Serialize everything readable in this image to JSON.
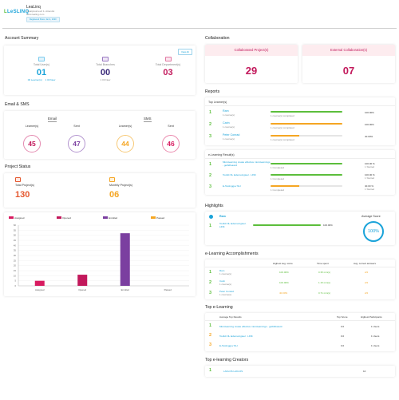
{
  "app": {
    "logo_text": "LeSLINQ",
    "company_name": "LeaLinq",
    "company_line1": "Cuiatpisurnevd 1- Attendst",
    "company_line2": "www.lealing.com",
    "company_button": "Registered Since: Jan 1, 2020"
  },
  "colors": {
    "primary_blue": "#1aa3d9",
    "green": "#5cbe3c",
    "orange": "#f5a623",
    "pink": "#d81b60",
    "purple": "#7b3fa0",
    "magenta": "#c2185b"
  },
  "account_summary": {
    "title": "Account Summary",
    "view_all": "View All",
    "stats": [
      {
        "label": "Total User(s)",
        "value": "01",
        "sub1": "00 Learner(s)",
        "sub2": "1 00 New",
        "color": "#1aa3d9",
        "icon": "users-icon"
      },
      {
        "label": "Total Branches",
        "value": "00",
        "sub1": "",
        "sub2": "1 00 New",
        "color": "#3a2a7a",
        "icon": "branch-icon"
      },
      {
        "label": "Total Department(s)",
        "value": "03",
        "sub1": "",
        "sub2": "",
        "color": "#c2185b",
        "icon": "department-icon"
      }
    ]
  },
  "email_sms": {
    "title": "Email & SMS",
    "email_label": "Email",
    "sms_label": "SMS",
    "rings": [
      {
        "label": "Learner(s)",
        "value": "45",
        "color": "#c2185b"
      },
      {
        "label": "Sent",
        "value": "47",
        "color": "#7b3fa0"
      },
      {
        "label": "Learner(s)",
        "value": "44",
        "color": "#f5a623"
      },
      {
        "label": "Sent",
        "value": "46",
        "color": "#d81b60"
      }
    ]
  },
  "project_status": {
    "title": "Project Status",
    "total_label": "Total Project(s)",
    "total_value": "130",
    "monthly_label": "Monthly Project(s)",
    "monthly_value": "06"
  },
  "chart_data": {
    "type": "bar",
    "legend": [
      {
        "name": "Assigned",
        "color": "#d81b60"
      },
      {
        "name": "Opened",
        "color": "#c2185b"
      },
      {
        "name": "Enrolled",
        "color": "#7b3fa0"
      },
      {
        "name": "Passed",
        "color": "#f5a623"
      }
    ],
    "categories": [
      "Assigned",
      "Opened",
      "Enrolled",
      "Passed"
    ],
    "values": [
      5,
      11,
      52,
      0
    ],
    "colors": [
      "#d81b60",
      "#c2185b",
      "#7b3fa0",
      "#f5a623"
    ],
    "yticks": [
      "60",
      "55",
      "50",
      "45",
      "40",
      "35",
      "30",
      "25",
      "20",
      "15",
      "10",
      "5",
      "0"
    ],
    "ylim": [
      0,
      60
    ]
  },
  "collaboration": {
    "title": "Collaboration",
    "collab_label": "Collaborated Project(s)",
    "collab_value": "29",
    "external_label": "External Collaboration(s)",
    "external_value": "07"
  },
  "reports": {
    "title": "Reports",
    "top_learners_title": "Top Learner(s)",
    "learners": [
      {
        "rank": "1",
        "name": "Ram",
        "sub": "1 course(s)",
        "bar_label": "1 course(s) completed",
        "pct": "100.00%",
        "fill": 1.0,
        "color": "#5cbe3c"
      },
      {
        "rank": "2",
        "name": "Carin",
        "sub": "1 course(s)",
        "bar_label": "1 course(s) completed",
        "pct": "100.00%",
        "fill": 1.0,
        "color": "#f5a623"
      },
      {
        "rank": "3",
        "name": "Peter Conrad",
        "sub": "1 course(s)",
        "bar_label": "1 course(s) completed",
        "pct": "40.00%",
        "fill": 0.4,
        "color": "#f5a623"
      }
    ],
    "elearning_title": "e-Learning Result(s)",
    "results": [
      {
        "rank": "1",
        "name": "Microlearning create effective microlearnings - getfidfoawrd",
        "sub": "1 Completed",
        "pct": "100.00 %",
        "pct_sub": "1 Started",
        "fill": 1.0,
        "color": "#5cbe3c"
      },
      {
        "rank": "2",
        "name": "Toolkit NL lademeingteel . LINK",
        "sub": "1 Completed",
        "pct": "100.00 %",
        "pct_sub": "1 Started",
        "fill": 1.0,
        "color": "#5cbe3c"
      },
      {
        "rank": "3",
        "name": "E-Testinggov NLI",
        "sub": "1 Completed",
        "pct": "40.00 %",
        "pct_sub": "1 Started",
        "fill": 0.4,
        "color": "#f5a623"
      }
    ]
  },
  "highlights": {
    "title": "Highlights",
    "user_name": "Ram",
    "item_rank": "1",
    "item_name": "Toolkit NL lademeingteel . LINK",
    "item_pct": "100.00%",
    "fill": 1.0,
    "avg_label": "Average Score",
    "avg_value": "100%"
  },
  "accomplishments": {
    "title": "e-Learning Accomplishments",
    "headers": [
      "Highest avg. score",
      "Time spent",
      "Avg. correct answers"
    ],
    "rows": [
      {
        "rank": "1",
        "name": "Ram",
        "sub": "1 course(s)",
        "score": "100.00%",
        "time": "0.35 min(s)",
        "avg": "2/2",
        "color": "#5cbe3c"
      },
      {
        "rank": "2",
        "name": "Carin",
        "sub": "1 course(s)",
        "score": "100.00%",
        "time": "1.15 min(s)",
        "avg": "2/2",
        "color": "#5cbe3c"
      },
      {
        "rank": "3",
        "name": "Peter Conrad",
        "sub": "1 course(s)",
        "score": "40.00%",
        "time": "0.71 min(s)",
        "avg": "2/2",
        "color": "#f5a623"
      }
    ]
  },
  "top_elearning": {
    "title": "Top e-Learning",
    "headers": [
      "Average Top Results",
      "Top Score",
      "Highest Participants"
    ],
    "rows": [
      {
        "rank": "1",
        "name": "Microlearning create effective microlearnings - getfidfoawrd",
        "score": "0.0",
        "participants": "1 Users"
      },
      {
        "rank": "2",
        "name": "Toolkit NL lademeingteel . LINK",
        "score": "0.0",
        "participants": "1 Users"
      },
      {
        "rank": "3",
        "name": "E-Testinggov NLI",
        "score": "0.0",
        "participants": "1 Users"
      }
    ]
  },
  "creators": {
    "title": "Top e-learning Creators",
    "rows": [
      {
        "rank": "1",
        "name": "LAKLOS LAKLOS",
        "count": "10"
      }
    ]
  }
}
